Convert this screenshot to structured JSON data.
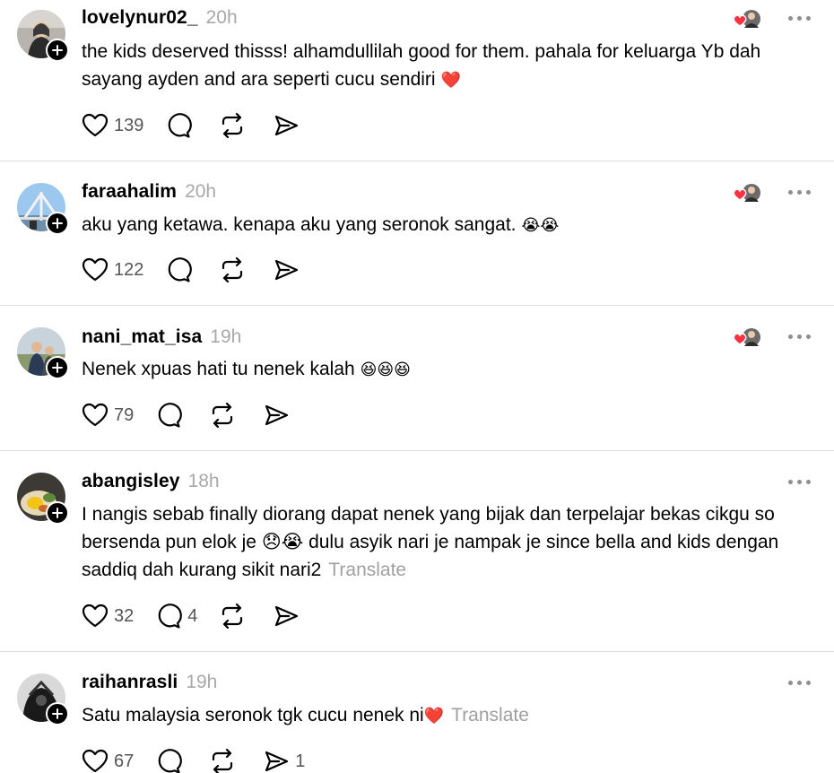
{
  "posts": [
    {
      "username": "lovelynur02_",
      "time": "20h",
      "text": "the kids deserved thisss! alhamdullilah good for them. pahala for keluarga Yb dah sayang ayden and ara seperti cucu sendiri",
      "emoji": "❤️",
      "translate": "",
      "likes": "139",
      "replies": "",
      "reposts": "",
      "shares": "",
      "liked_by_author": true
    },
    {
      "username": "faraahalim",
      "time": "20h",
      "text": "aku yang ketawa. kenapa aku yang seronok sangat.",
      "emoji": "😭😭",
      "translate": "",
      "likes": "122",
      "replies": "",
      "reposts": "",
      "shares": "",
      "liked_by_author": true
    },
    {
      "username": "nani_mat_isa",
      "time": "19h",
      "text": "Nenek xpuas hati tu nenek kalah",
      "emoji": "😆😆😆",
      "translate": "",
      "likes": "79",
      "replies": "",
      "reposts": "",
      "shares": "",
      "liked_by_author": true
    },
    {
      "username": "abangisley",
      "time": "18h",
      "text": "I nangis sebab finally diorang dapat nenek yang bijak dan terpelajar bekas cikgu so bersenda pun elok je 😞😭 dulu asyik nari je nampak je since bella and kids dengan saddiq dah kurang sikit nari2",
      "emoji": "",
      "translate": "Translate",
      "likes": "32",
      "replies": "4",
      "reposts": "",
      "shares": "",
      "liked_by_author": false
    },
    {
      "username": "raihanrasli",
      "time": "19h",
      "text": "Satu malaysia seronok tgk cucu nenek ni",
      "emoji": "❤️",
      "translate": "Translate",
      "likes": "67",
      "replies": "",
      "reposts": "",
      "shares": "1",
      "liked_by_author": false
    }
  ],
  "icons": {
    "like": "heart-icon",
    "reply": "comment-bubble-icon",
    "repost": "repost-icon",
    "share": "send-icon",
    "more": "more-dots-icon",
    "follow": "plus-icon"
  },
  "colors": {
    "text": "#000000",
    "muted": "#a8a8a8",
    "divider": "#dedede",
    "heart_red": "#ff3040"
  }
}
